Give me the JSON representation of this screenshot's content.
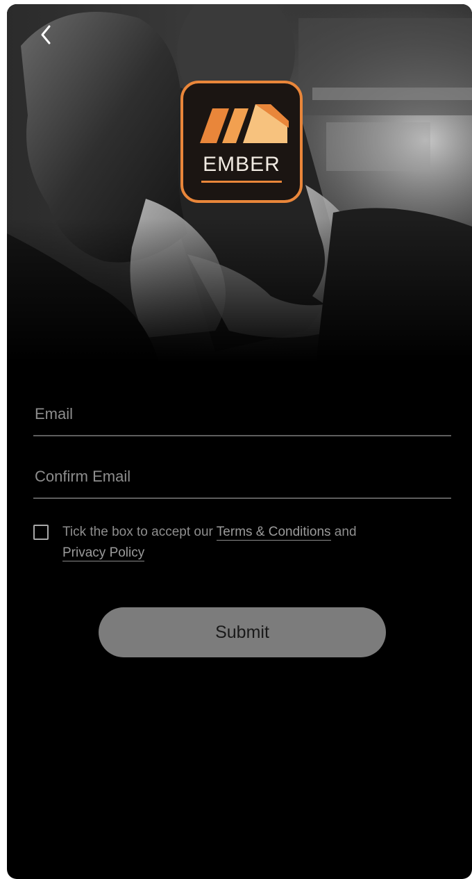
{
  "header": {
    "back_icon": "chevron-left-icon"
  },
  "logo": {
    "text": "EMBER",
    "accent_color": "#e9863a"
  },
  "form": {
    "email_placeholder": "Email",
    "email_value": "",
    "confirm_email_placeholder": "Confirm Email",
    "confirm_email_value": "",
    "terms": {
      "checked": false,
      "prefix": "Tick the box to accept our ",
      "terms_link": "Terms & Conditions",
      "middle": " and",
      "privacy_link": "Privacy Policy"
    },
    "submit_label": "Submit"
  }
}
